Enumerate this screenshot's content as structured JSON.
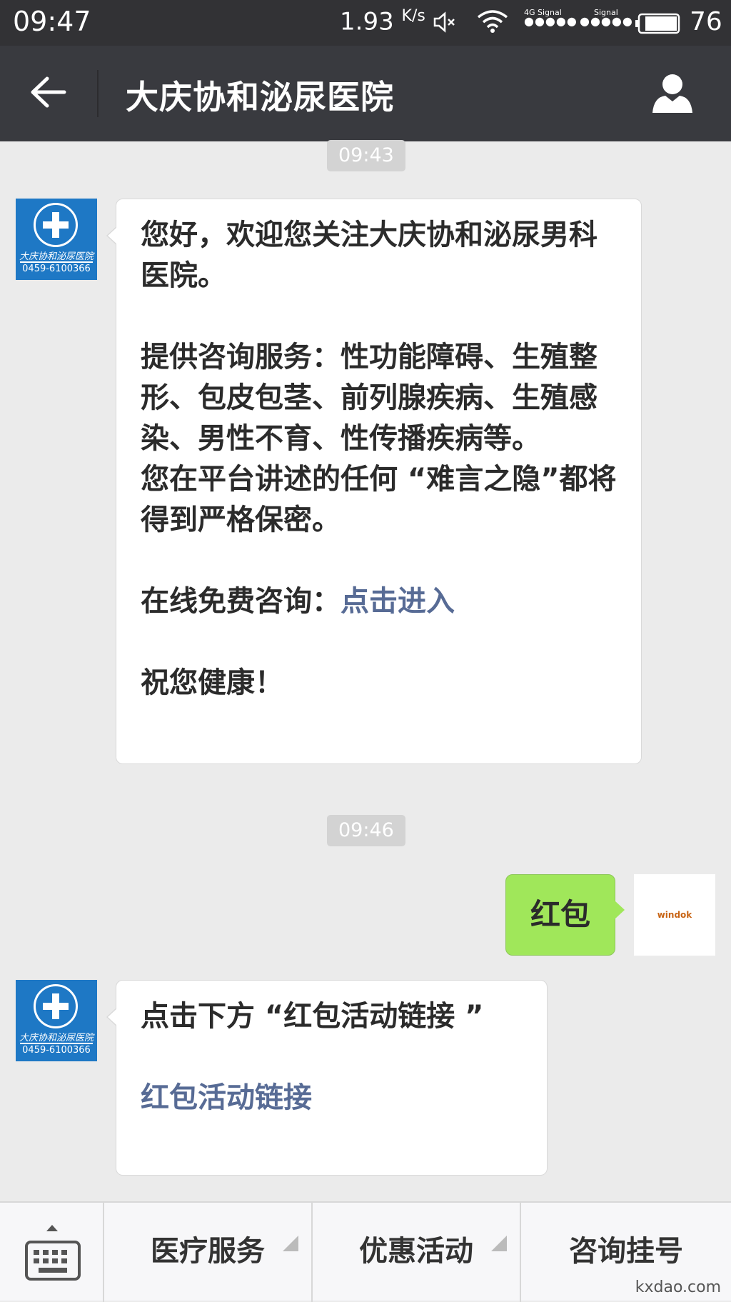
{
  "status_bar": {
    "time": "09:47",
    "speed": "1.93",
    "speed_unit": "K/s",
    "network_label": "4G Signal",
    "signal_label": "Signal",
    "battery": "76",
    "icons": [
      "mute-icon",
      "wifi-icon",
      "battery-icon"
    ]
  },
  "header": {
    "title": "大庆协和泌尿医院",
    "icons": [
      "back-arrow-icon",
      "profile-icon"
    ]
  },
  "avatar": {
    "name": "大庆协和泌尿医院",
    "phone": "0459-6100366"
  },
  "chat": {
    "timestamp_1": "09:43",
    "welcome_p1": "您好，欢迎您关注大庆协和泌尿男科医院。",
    "welcome_p2": "提供咨询服务：性功能障碍、生殖整形、包皮包茎、前列腺疾病、生殖感染、男性不育、性传播疾病等。",
    "welcome_p3": "您在平台讲述的任何 “难言之隐”都将得到严格保密。",
    "consult_prefix": "在线免费咨询：",
    "consult_link": "点击进入",
    "wish": "祝您健康！",
    "timestamp_2": "09:46",
    "my_message": "红包",
    "my_avatar_label": "windok",
    "reply_text": "点击下方 “红包活动链接 ”",
    "reply_link": "红包活动链接"
  },
  "menu": {
    "items": [
      "医疗服务",
      "优惠活动",
      "咨询挂号"
    ],
    "icons": [
      "keyboard-icon",
      "caret-up-icon"
    ]
  },
  "watermark": "kxdao.com",
  "colors": {
    "status_bar": "#323235",
    "title_bar": "#393a3f",
    "chat_bg": "#ebebeb",
    "link": "#576b95",
    "my_bubble": "#a0e75a",
    "avatar_bg": "#1e78c5"
  }
}
